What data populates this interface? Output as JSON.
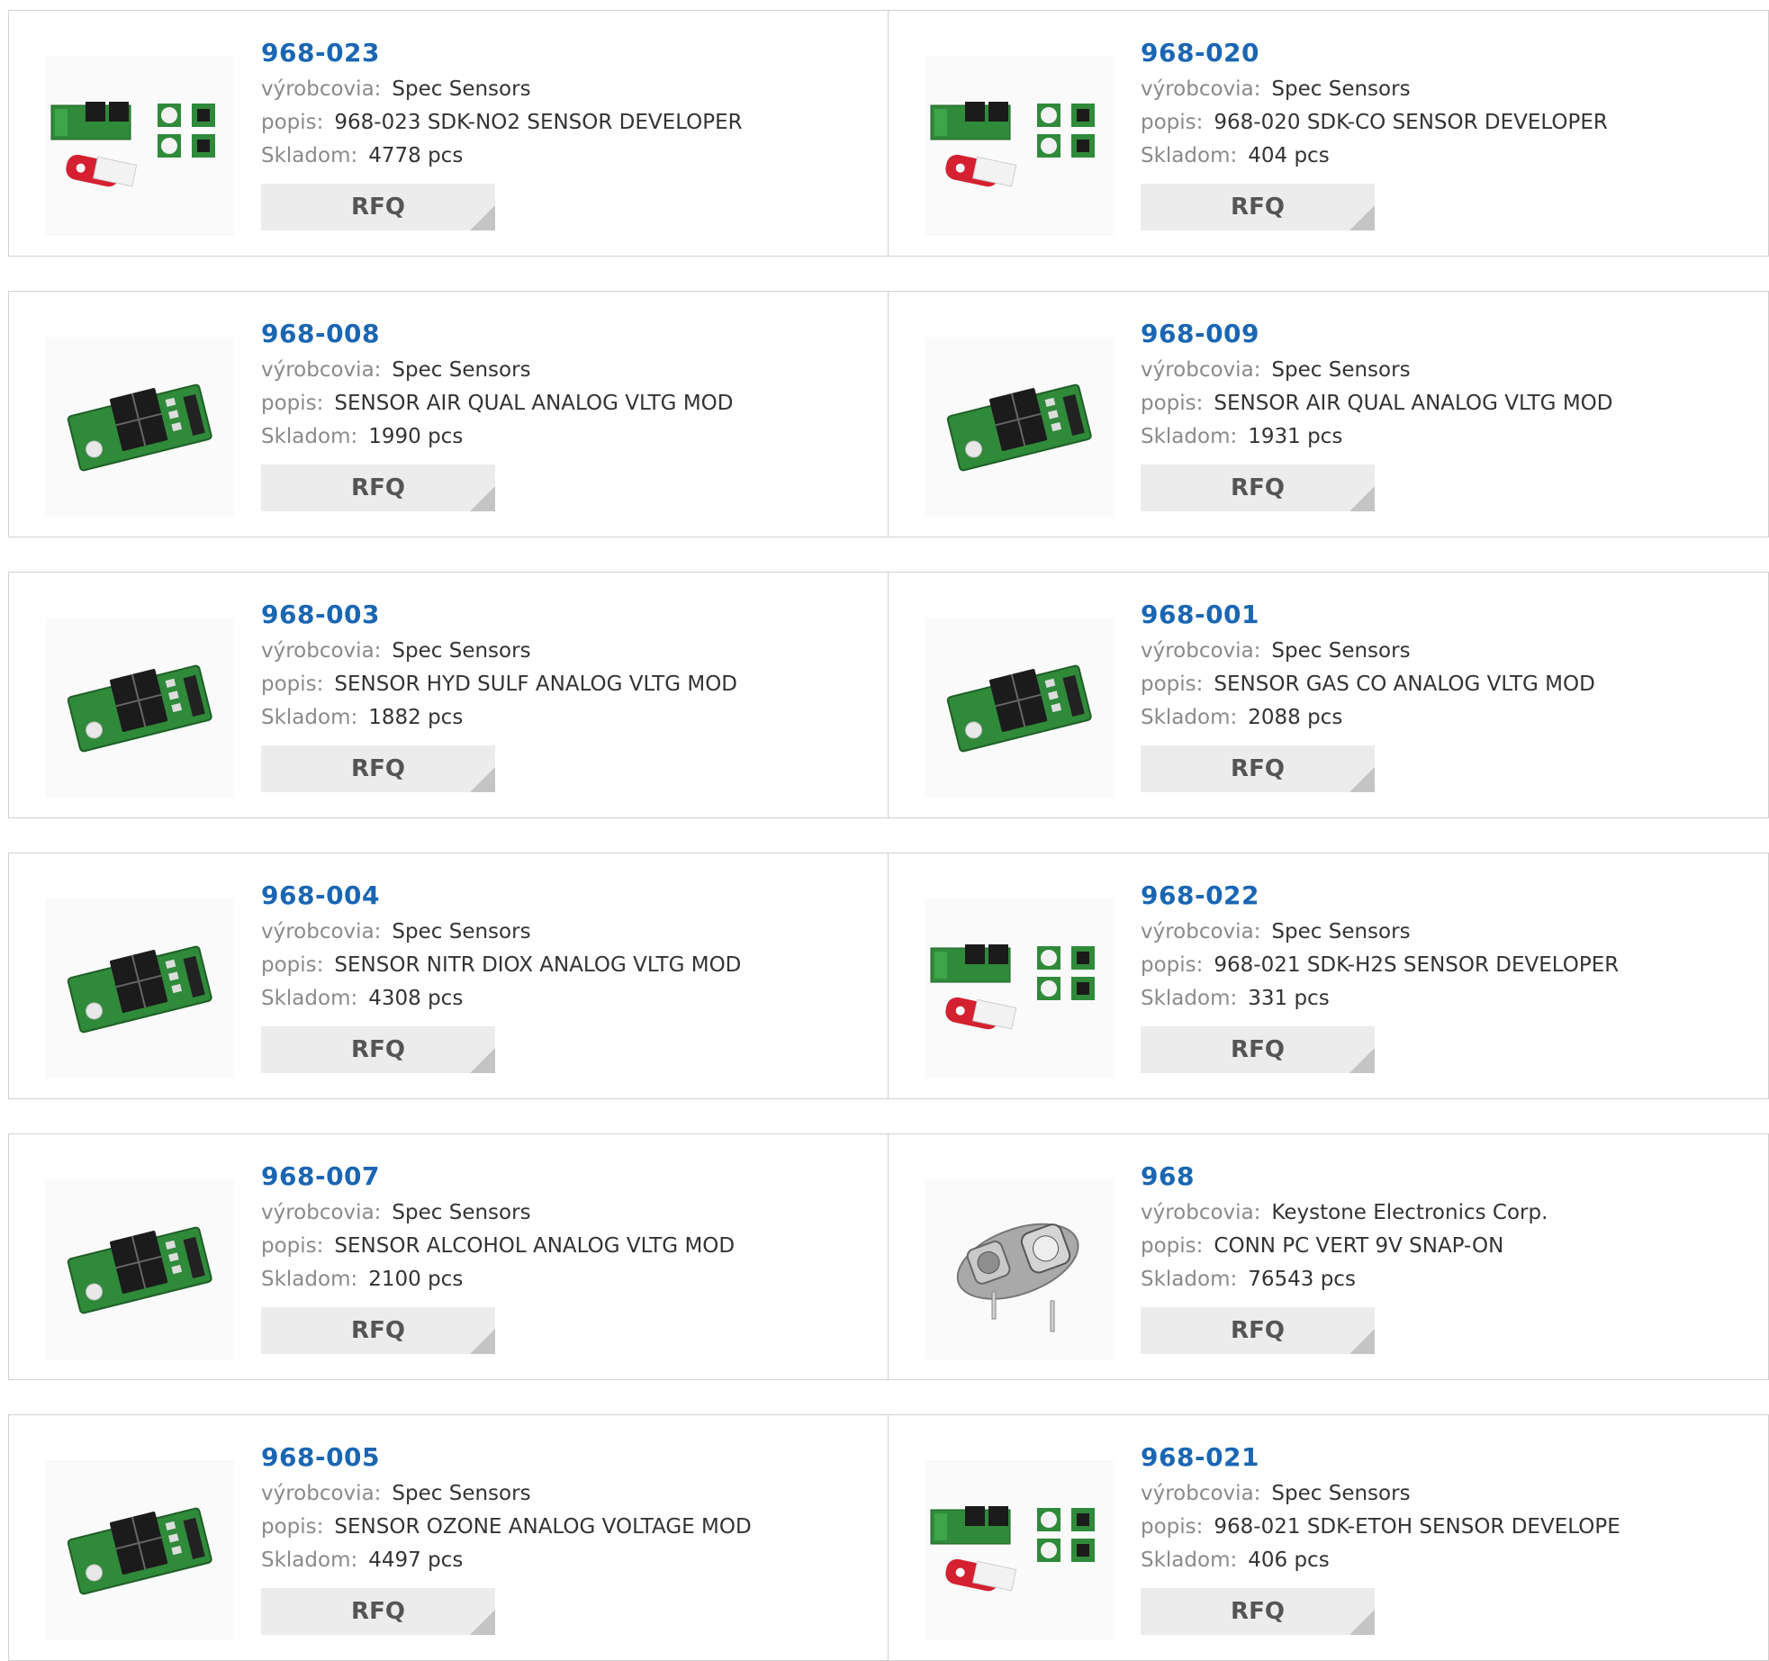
{
  "labels": {
    "manufacturer": "výrobcovia:",
    "description": "popis:",
    "stock": "Skladom:",
    "rfq": "RFQ"
  },
  "products": [
    {
      "part": "968-023",
      "manufacturer": "Spec Sensors",
      "description": "968-023 SDK-NO2 SENSOR DEVELOPER",
      "stock": "4778 pcs",
      "image": "sdk-kit-image"
    },
    {
      "part": "968-020",
      "manufacturer": "Spec Sensors",
      "description": "968-020 SDK-CO SENSOR DEVELOPER",
      "stock": "404 pcs",
      "image": "sdk-kit-image"
    },
    {
      "part": "968-008",
      "manufacturer": "Spec Sensors",
      "description": "SENSOR AIR QUAL ANALOG VLTG MOD",
      "stock": "1990 pcs",
      "image": "sensor-module-image"
    },
    {
      "part": "968-009",
      "manufacturer": "Spec Sensors",
      "description": "SENSOR AIR QUAL ANALOG VLTG MOD",
      "stock": "1931 pcs",
      "image": "sensor-module-image"
    },
    {
      "part": "968-003",
      "manufacturer": "Spec Sensors",
      "description": "SENSOR HYD SULF ANALOG VLTG MOD",
      "stock": "1882 pcs",
      "image": "sensor-module-image"
    },
    {
      "part": "968-001",
      "manufacturer": "Spec Sensors",
      "description": "SENSOR GAS CO ANALOG VLTG MOD",
      "stock": "2088 pcs",
      "image": "sensor-module-image"
    },
    {
      "part": "968-004",
      "manufacturer": "Spec Sensors",
      "description": "SENSOR NITR DIOX ANALOG VLTG MOD",
      "stock": "4308 pcs",
      "image": "sensor-module-image"
    },
    {
      "part": "968-022",
      "manufacturer": "Spec Sensors",
      "description": "968-021 SDK-H2S SENSOR DEVELOPER",
      "stock": "331 pcs",
      "image": "sdk-kit-image"
    },
    {
      "part": "968-007",
      "manufacturer": "Spec Sensors",
      "description": "SENSOR ALCOHOL ANALOG VLTG MOD",
      "stock": "2100 pcs",
      "image": "sensor-module-image"
    },
    {
      "part": "968",
      "manufacturer": "Keystone Electronics Corp.",
      "description": "CONN PC VERT 9V SNAP-ON",
      "stock": "76543 pcs",
      "image": "battery-snap-image"
    },
    {
      "part": "968-005",
      "manufacturer": "Spec Sensors",
      "description": "SENSOR OZONE ANALOG VOLTAGE MOD",
      "stock": "4497 pcs",
      "image": "sensor-module-image"
    },
    {
      "part": "968-021",
      "manufacturer": "Spec Sensors",
      "description": "968-021 SDK-ETOH SENSOR DEVELOPE",
      "stock": "406 pcs",
      "image": "sdk-kit-image"
    }
  ],
  "colors": {
    "part_link": "#1a66b3",
    "label_gray": "#8a8a8a",
    "button_bg": "#ececec",
    "pcb_green": "#2f8a3a"
  }
}
